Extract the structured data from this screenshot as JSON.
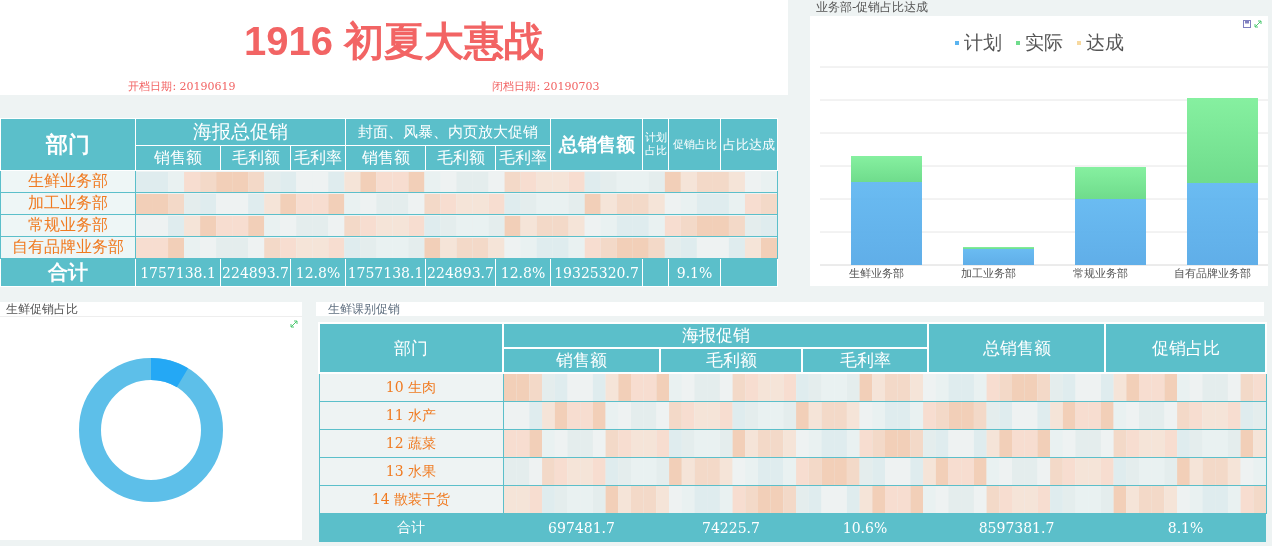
{
  "header": {
    "title": "1916 初夏大惠战",
    "start_date": "开档日期: 20190619",
    "end_date": "闭档日期: 20190703"
  },
  "summary_table": {
    "groups": [
      {
        "label": "部门"
      },
      {
        "label": "海报总促销",
        "sub": [
          "销售额",
          "毛利额",
          "毛利率"
        ]
      },
      {
        "label": "封面、风暴、内页放大促销",
        "sub": [
          "销售额",
          "毛利额",
          "毛利率"
        ]
      },
      {
        "label": "总销售额"
      },
      {
        "label": "计划占比"
      },
      {
        "label": "促销占比"
      },
      {
        "label": "占比达成"
      }
    ],
    "rows": [
      "生鲜业务部",
      "加工业务部",
      "常规业务部",
      "自有品牌业务部"
    ],
    "total": {
      "label": "合计",
      "values": [
        "1757138.1",
        "224893.7",
        "12.8%",
        "1757138.1",
        "224893.7",
        "12.8%",
        "19325320.7",
        "9.1%"
      ]
    }
  },
  "bar_panel": {
    "title": "业务部-促销占比达成",
    "legend": [
      {
        "label": "计划",
        "color": "#5ab4f0"
      },
      {
        "label": "实际",
        "color": "#6fdc8c"
      },
      {
        "label": "达成",
        "color": "#f7d9a0"
      }
    ],
    "categories": [
      "生鲜业务部",
      "加工业务部",
      "常规业务部",
      "自有品牌业务部"
    ]
  },
  "donut_panel": {
    "title": "生鲜促销占比"
  },
  "category_table": {
    "title": "生鲜课别促销",
    "groups": [
      {
        "label": "部门"
      },
      {
        "label": "海报促销",
        "sub": [
          "销售额",
          "毛利额",
          "毛利率"
        ]
      },
      {
        "label": "总销售额"
      },
      {
        "label": "促销占比"
      }
    ],
    "rows": [
      "10 生肉",
      "11 水产",
      "12 蔬菜",
      "13 水果",
      "14 散装干货"
    ],
    "total": {
      "label": "合计",
      "values": [
        "697481.7",
        "74225.7",
        "10.6%",
        "8597381.7",
        "8.1%"
      ]
    }
  }
}
